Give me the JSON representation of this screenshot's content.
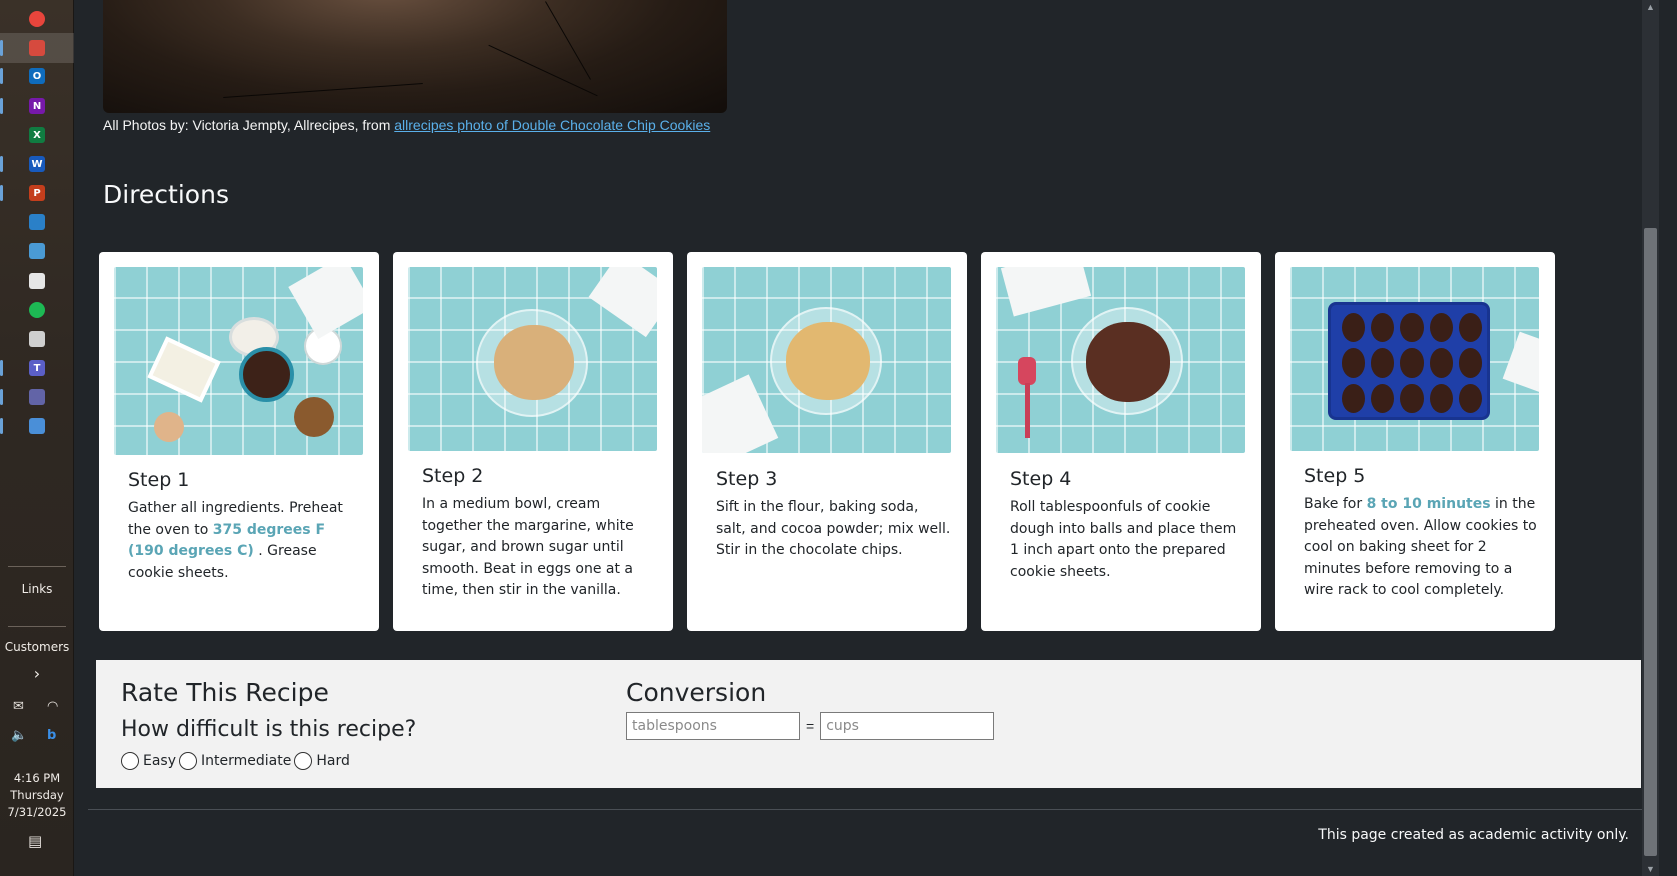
{
  "taskbar": {
    "apps": [
      {
        "name": "chrome",
        "glyph": "",
        "color": "#e8453c"
      },
      {
        "name": "vpn",
        "glyph": "",
        "color": "#d64a3e"
      },
      {
        "name": "outlook",
        "glyph": "O",
        "color": "#0f6cbd"
      },
      {
        "name": "onenote",
        "glyph": "N",
        "color": "#7719aa"
      },
      {
        "name": "excel",
        "glyph": "X",
        "color": "#107c41"
      },
      {
        "name": "word",
        "glyph": "W",
        "color": "#185abd"
      },
      {
        "name": "powerpoint",
        "glyph": "P",
        "color": "#c43e1c"
      },
      {
        "name": "gamepad",
        "glyph": "",
        "color": "#2a80c8"
      },
      {
        "name": "mobile",
        "glyph": "",
        "color": "#4a9ad4"
      },
      {
        "name": "puzzle",
        "glyph": "",
        "color": "#e6e6e6"
      },
      {
        "name": "status",
        "glyph": "",
        "color": "#1db954"
      },
      {
        "name": "calc",
        "glyph": "",
        "color": "#cfcfcf"
      },
      {
        "name": "teams",
        "glyph": "T",
        "color": "#5b5fc7"
      },
      {
        "name": "teams2",
        "glyph": "",
        "color": "#6264a7"
      },
      {
        "name": "gear",
        "glyph": "",
        "color": "#4a8fd8"
      }
    ],
    "links_label": "Links",
    "customers_label": "Customers",
    "time": "4:16 PM",
    "day": "Thursday",
    "date": "7/31/2025"
  },
  "page": {
    "photo_credit_prefix": "All Photos by: Victoria Jempty, Allrecipes, from",
    "photo_credit_link": "allrecipes photo of Double Chocolate Chip Cookies",
    "directions_heading": "Directions",
    "steps": [
      {
        "title": "Step 1",
        "text_before": "Gather all ingredients. Preheat the oven to ",
        "highlight": "375 degrees F (190 degrees C)",
        "text_after": " . Grease cookie sheets."
      },
      {
        "title": "Step 2",
        "text_before": "In a medium bowl, cream together the margarine, white sugar, and brown sugar until smooth. Beat in eggs one at a time, then stir in the vanilla.",
        "highlight": "",
        "text_after": ""
      },
      {
        "title": "Step 3",
        "text_before": "Sift in the flour, baking soda, salt, and cocoa powder; mix well. Stir in the chocolate chips.",
        "highlight": "",
        "text_after": ""
      },
      {
        "title": "Step 4",
        "text_before": "Roll tablespoonfuls of cookie dough into balls and place them 1 inch apart onto the prepared cookie sheets.",
        "highlight": "",
        "text_after": ""
      },
      {
        "title": "Step 5",
        "text_before": "Bake for ",
        "highlight": "8 to 10 minutes",
        "text_after": " in the preheated oven. Allow cookies to cool on baking sheet for 2 minutes before removing to a wire rack to cool completely."
      }
    ],
    "rate": {
      "title": "Rate This Recipe",
      "question": "How difficult is this recipe?",
      "options": [
        "Easy",
        "Intermediate",
        "Hard"
      ]
    },
    "conversion": {
      "title": "Conversion",
      "from_placeholder": "tablespoons",
      "to_placeholder": "cups",
      "equals": "="
    },
    "footer": "This page created as academic activity only."
  }
}
